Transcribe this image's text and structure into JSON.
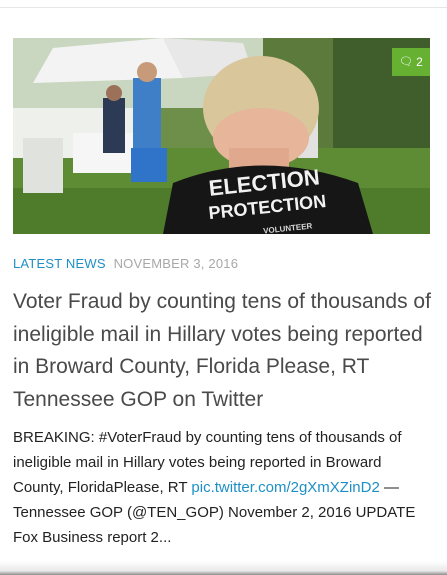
{
  "post": {
    "comment_count": "2",
    "comment_icon": "comments-icon",
    "hero_shirt_text_line1": "ELECTION",
    "hero_shirt_text_line2": "PROTECTION",
    "hero_shirt_text_line3": "VOLUNTEER",
    "category": "LATEST NEWS",
    "date": "NOVEMBER 3, 2016",
    "title": "Voter Fraud by counting tens of thousands of ineligible mail in Hillary votes being reported in Broward County, Florida Please, RT Tennessee GOP on Twitter",
    "excerpt_part1": "BREAKING: #VoterFraud by counting tens of thousands of ineligible mail in Hillary votes being reported in Broward County, FloridaPlease, RT ",
    "excerpt_link": "pic.twitter.com/2gXmXZinD2",
    "excerpt_part2": " — Tennessee GOP (@TEN_GOP) November 2, 2016 UPDATE Fox Business report 2..."
  },
  "colors": {
    "accent_blue": "#1e8fc6",
    "badge_green": "#66b032",
    "date_gray": "#a8a8a8",
    "title_gray": "#4a4a4a"
  }
}
